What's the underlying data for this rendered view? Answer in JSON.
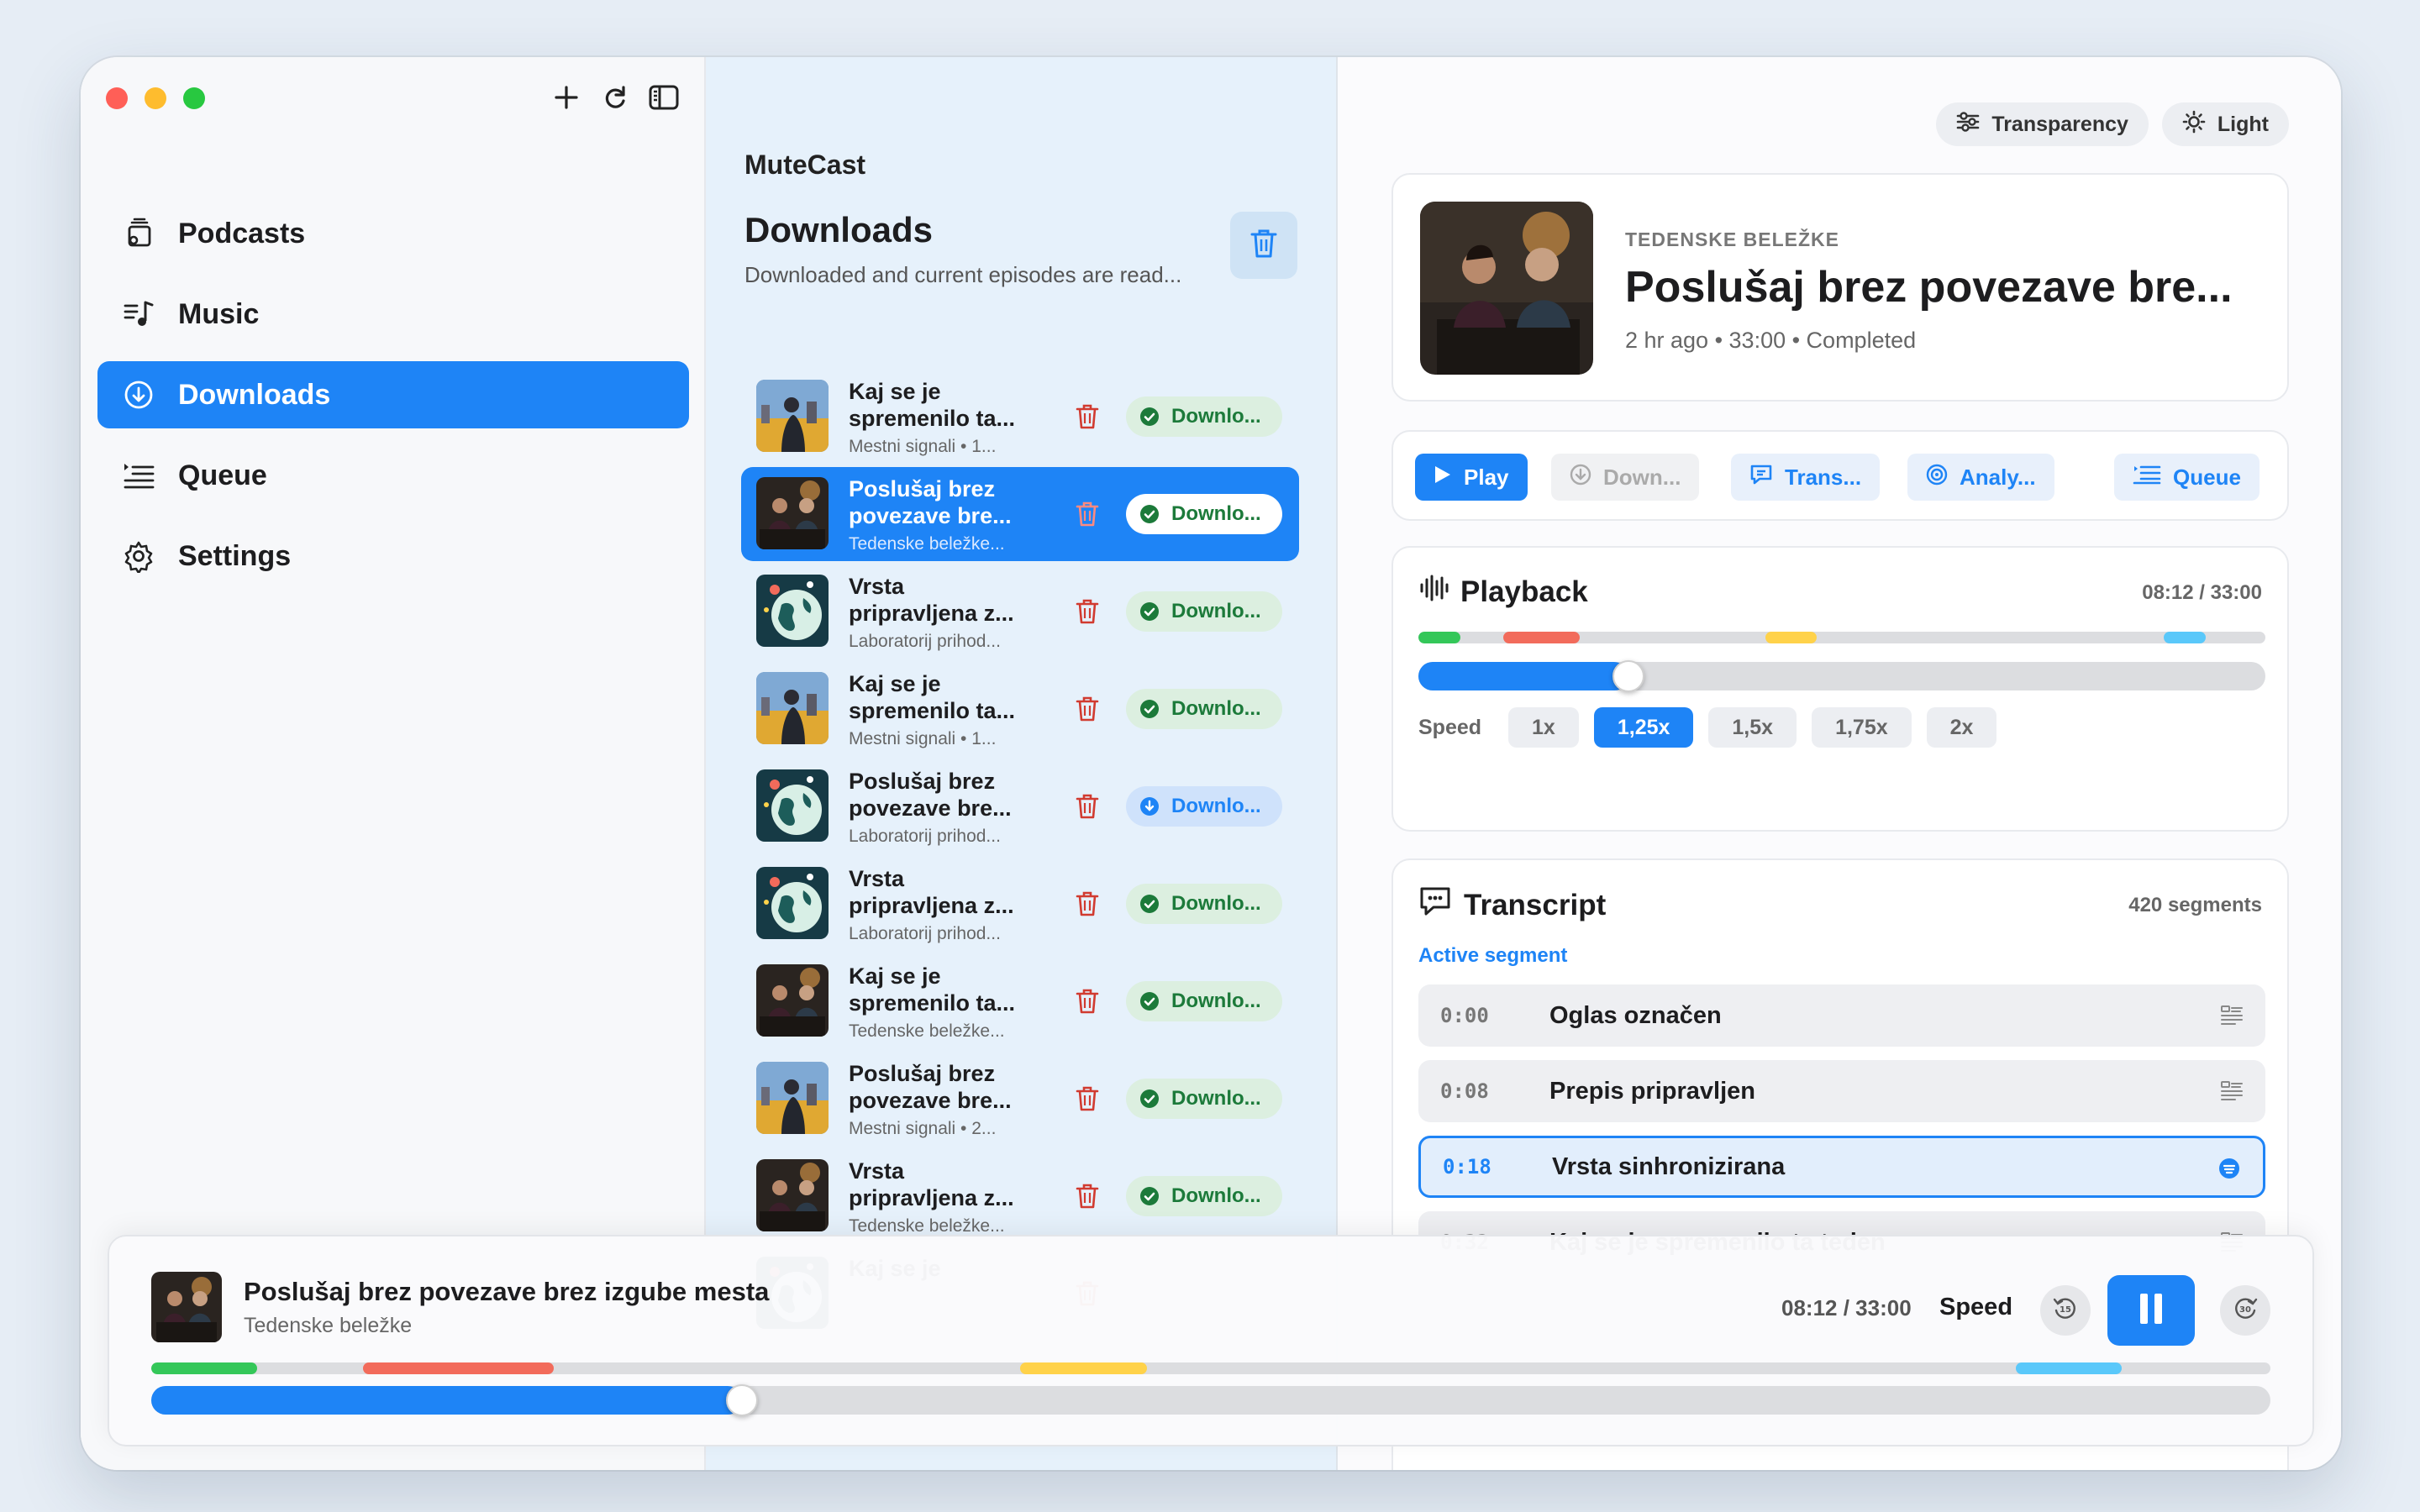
{
  "app": {
    "brand": "MuteCast"
  },
  "sidebar": {
    "items": [
      {
        "label": "Podcasts",
        "icon": "podcasts-icon",
        "active": false
      },
      {
        "label": "Music",
        "icon": "music-icon",
        "active": false
      },
      {
        "label": "Downloads",
        "icon": "download-icon",
        "active": true
      },
      {
        "label": "Queue",
        "icon": "queue-icon",
        "active": false
      },
      {
        "label": "Settings",
        "icon": "gear-icon",
        "active": false
      }
    ]
  },
  "downloads": {
    "title": "Downloads",
    "subtitle": "Downloaded and current episodes are read...",
    "rows": [
      {
        "title": "Kaj se je spremenilo ta...",
        "meta": "Mestni signali • 1...",
        "status": "Downlo...",
        "thumb": "city",
        "selected": false,
        "state": "done"
      },
      {
        "title": "Poslušaj brez povezave bre...",
        "meta": "Tedenske beležke...",
        "status": "Downlo...",
        "thumb": "room",
        "selected": true,
        "state": "done"
      },
      {
        "title": "Vrsta pripravljena z...",
        "meta": "Laboratorij prihod...",
        "status": "Downlo...",
        "thumb": "globe",
        "selected": false,
        "state": "done"
      },
      {
        "title": "Kaj se je spremenilo ta...",
        "meta": "Mestni signali • 1...",
        "status": "Downlo...",
        "thumb": "city",
        "selected": false,
        "state": "done"
      },
      {
        "title": "Poslušaj brez povezave bre...",
        "meta": "Laboratorij prihod...",
        "status": "Downlo...",
        "thumb": "globe",
        "selected": false,
        "state": "progress"
      },
      {
        "title": "Vrsta pripravljena z...",
        "meta": "Laboratorij prihod...",
        "status": "Downlo...",
        "thumb": "globe",
        "selected": false,
        "state": "done"
      },
      {
        "title": "Kaj se je spremenilo ta...",
        "meta": "Tedenske beležke...",
        "status": "Downlo...",
        "thumb": "room",
        "selected": false,
        "state": "done"
      },
      {
        "title": "Poslušaj brez povezave bre...",
        "meta": "Mestni signali • 2...",
        "status": "Downlo...",
        "thumb": "city",
        "selected": false,
        "state": "done"
      },
      {
        "title": "Vrsta pripravljena z...",
        "meta": "Tedenske beležke...",
        "status": "Downlo...",
        "thumb": "room",
        "selected": false,
        "state": "done"
      },
      {
        "title": "Kaj se je",
        "meta": "",
        "status": "",
        "thumb": "globe",
        "selected": false,
        "state": "done"
      }
    ]
  },
  "toolbar": {
    "transparency": "Transparency",
    "light": "Light"
  },
  "episode": {
    "kicker": "TEDENSKE BELEŽKE",
    "title": "Poslušaj brez povezave bre...",
    "meta": "2 hr ago • 33:00 • Completed"
  },
  "actions": {
    "play": "Play",
    "download": "Down...",
    "transcript": "Trans...",
    "analysis": "Analy...",
    "queue": "Queue"
  },
  "playback": {
    "title": "Playback",
    "time": "08:12 / 33:00",
    "progress": 0.2485,
    "segments": [
      {
        "start": 0.0,
        "end": 0.05,
        "color": "#34c759"
      },
      {
        "start": 0.1,
        "end": 0.19,
        "color": "#f26b5b"
      },
      {
        "start": 0.41,
        "end": 0.47,
        "color": "#ffd24a"
      },
      {
        "start": 0.88,
        "end": 0.93,
        "color": "#5ac8fa"
      }
    ],
    "speed_label": "Speed",
    "speeds": [
      "1x",
      "1,25x",
      "1,5x",
      "1,75x",
      "2x"
    ],
    "speed_selected": "1,25x"
  },
  "transcript": {
    "title": "Transcript",
    "count": "420 segments",
    "active_label": "Active segment",
    "rows": [
      {
        "time": "0:00",
        "text": "Oglas označen",
        "current": false
      },
      {
        "time": "0:08",
        "text": "Prepis pripravljen",
        "current": false
      },
      {
        "time": "0:18",
        "text": "Vrsta sinhronizirana",
        "current": true
      },
      {
        "time": "0:32",
        "text": "Kaj se je spremenilo ta teden",
        "current": false
      }
    ]
  },
  "player": {
    "title": "Poslušaj brez povezave brez izgube mesta",
    "subtitle": "Tedenske beležke",
    "time": "08:12 / 33:00",
    "speed_label": "Speed",
    "progress": 0.2787,
    "colors": {
      "accent": "#1e84f6"
    }
  }
}
